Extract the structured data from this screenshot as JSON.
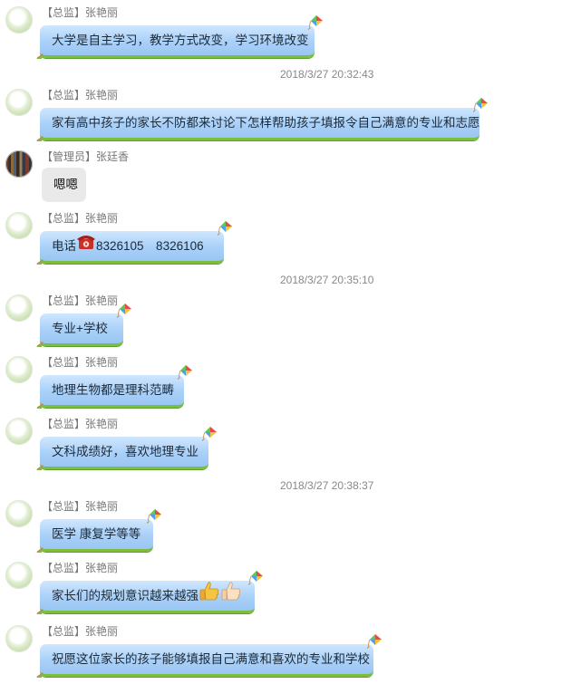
{
  "messages": [
    {
      "role": "【总监】",
      "name": "张艳丽",
      "text": "大学是自主学习，教学方式改变，学习环境改变"
    },
    {
      "role": "【总监】",
      "name": "张艳丽",
      "text": "家有高中孩子的家长不防都来讨论下怎样帮助孩子填报令自己满意的专业和志愿"
    },
    {
      "role": "【管理员】",
      "name": "张廷香",
      "text": "嗯嗯"
    },
    {
      "role": "【总监】",
      "name": "张艳丽",
      "text_prefix": "电话",
      "text_suffix": "8326105　8326106",
      "icon": "telephone-icon"
    },
    {
      "role": "【总监】",
      "name": "张艳丽",
      "text": "专业+学校"
    },
    {
      "role": "【总监】",
      "name": "张艳丽",
      "text": "地理生物都是理科范畴"
    },
    {
      "role": "【总监】",
      "name": "张艳丽",
      "text": "文科成绩好，喜欢地理专业"
    },
    {
      "role": "【总监】",
      "name": "张艳丽",
      "text": "医学 康复学等等"
    },
    {
      "role": "【总监】",
      "name": "张艳丽",
      "text": "家长们的规划意识越来越强",
      "icons": [
        "thumbs-up-icon",
        "thumbs-up-icon"
      ]
    },
    {
      "role": "【总监】",
      "name": "张艳丽",
      "text": "祝愿这位家长的孩子能够填报自己满意和喜欢的专业和学校"
    }
  ],
  "timestamps": [
    "2018/3/27 20:32:43",
    "2018/3/27 20:35:10",
    "2018/3/27 20:38:37"
  ],
  "colors": {
    "bubble_blue": "#a9d0f8",
    "bubble_border": "#7dbf3c",
    "bubble_gray": "#e9e9e9",
    "meta_text": "#888888"
  }
}
